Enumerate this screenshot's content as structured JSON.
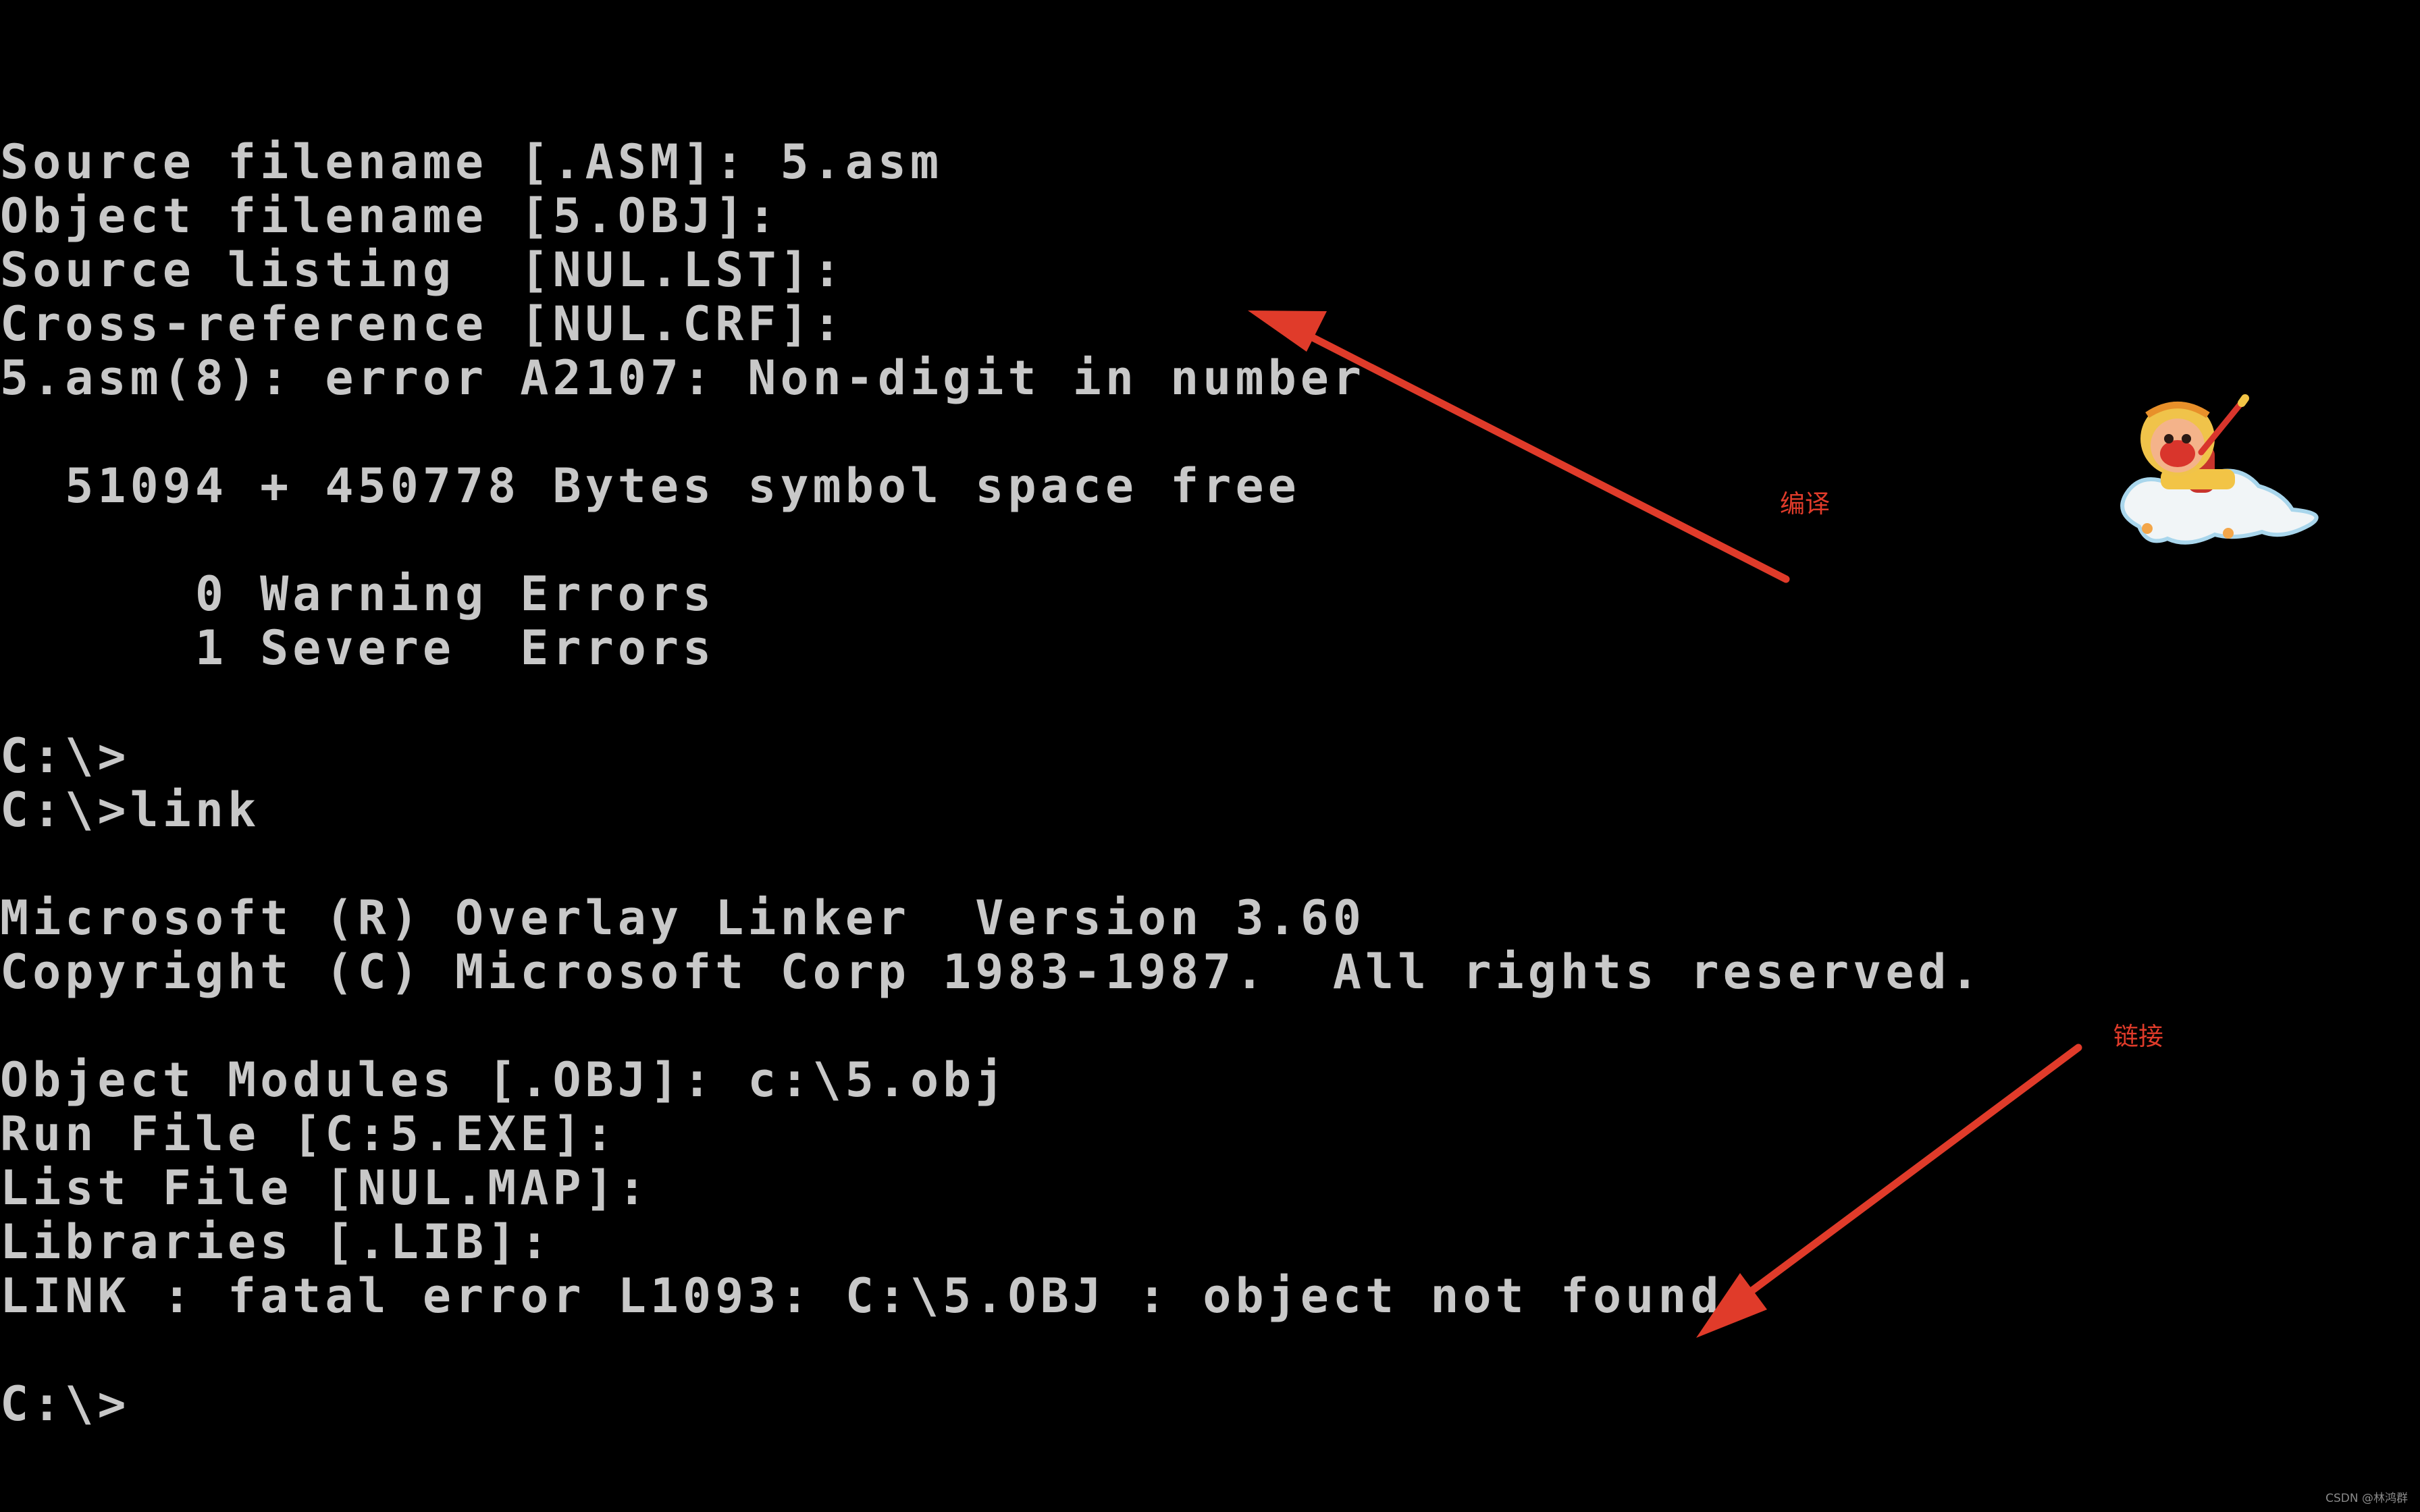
{
  "terminal": {
    "lines": {
      "l1": "Source filename [.ASM]: 5.asm",
      "l2": "Object filename [5.OBJ]:",
      "l3": "Source listing  [NUL.LST]:",
      "l4": "Cross-reference [NUL.CRF]:",
      "l5": "5.asm(8): error A2107: Non-digit in number",
      "l6": "  51094 + 450778 Bytes symbol space free",
      "l7": "      0 Warning Errors",
      "l8": "      1 Severe  Errors",
      "l9": "C:\\>",
      "l10": "C:\\>link",
      "l11": "Microsoft (R) Overlay Linker  Version 3.60",
      "l12": "Copyright (C) Microsoft Corp 1983-1987.  All rights reserved.",
      "l13": "Object Modules [.OBJ]: c:\\5.obj",
      "l14": "Run File [C:5.EXE]:",
      "l15": "List File [NUL.MAP]:",
      "l16": "Libraries [.LIB]:",
      "l17": "LINK : fatal error L1093: C:\\5.OBJ : object not found",
      "l18": "C:\\>"
    }
  },
  "annotations": {
    "compile_label": "编译",
    "link_label": "链接"
  },
  "watermark": "CSDN @林鸿群",
  "colors": {
    "background": "#000000",
    "terminal_text": "#c8c8c8",
    "annotation_red": "#e03b2a"
  }
}
